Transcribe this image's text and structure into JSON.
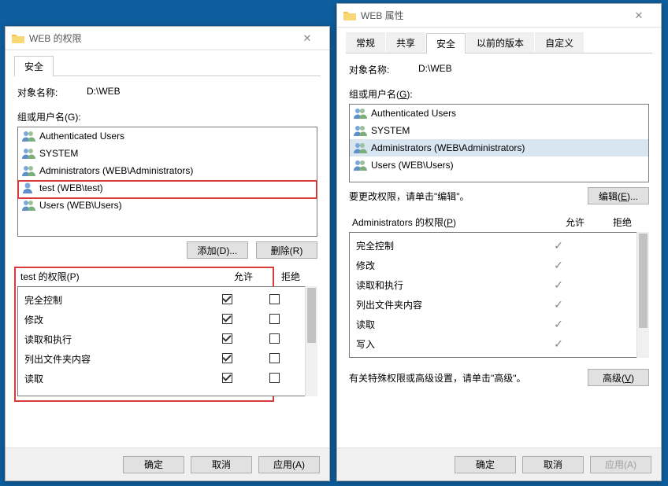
{
  "left": {
    "title": "WEB 的权限",
    "tabs": [
      "安全"
    ],
    "activeTab": 0,
    "objectLabel": "对象名称:",
    "objectValue": "D:\\WEB",
    "groupsLabel": "组或用户名(G):",
    "users": [
      {
        "name": "Authenticated Users",
        "type": "group"
      },
      {
        "name": "SYSTEM",
        "type": "group"
      },
      {
        "name": "Administrators (WEB\\Administrators)",
        "type": "group"
      },
      {
        "name": "test (WEB\\test)",
        "type": "user",
        "highlighted": true
      },
      {
        "name": "Users (WEB\\Users)",
        "type": "group"
      }
    ],
    "btnAdd": "添加(D)...",
    "btnRemove": "删除(R)",
    "permTitle": "test 的权限(P)",
    "colAllow": "允许",
    "colDeny": "拒绝",
    "perms": [
      {
        "name": "完全控制",
        "allow": true,
        "deny": false
      },
      {
        "name": "修改",
        "allow": true,
        "deny": false
      },
      {
        "name": "读取和执行",
        "allow": true,
        "deny": false
      },
      {
        "name": "列出文件夹内容",
        "allow": true,
        "deny": false
      },
      {
        "name": "读取",
        "allow": true,
        "deny": false
      }
    ],
    "btnOk": "确定",
    "btnCancel": "取消",
    "btnApply": "应用(A)"
  },
  "right": {
    "title": "WEB 属性",
    "tabs": [
      "常规",
      "共享",
      "安全",
      "以前的版本",
      "自定义"
    ],
    "activeTab": 2,
    "objectLabel": "对象名称:",
    "objectValue": "D:\\WEB",
    "groupsLabel": "组或用户名(G):",
    "users": [
      {
        "name": "Authenticated Users",
        "type": "group"
      },
      {
        "name": "SYSTEM",
        "type": "group"
      },
      {
        "name": "Administrators (WEB\\Administrators)",
        "type": "group",
        "selected": true
      },
      {
        "name": "Users (WEB\\Users)",
        "type": "group"
      }
    ],
    "editHint": "要更改权限，请单击\"编辑\"。",
    "btnEdit": "编辑(E)...",
    "permTitle": "Administrators 的权限(P)",
    "colAllow": "允许",
    "colDeny": "拒绝",
    "perms": [
      {
        "name": "完全控制",
        "allow": true
      },
      {
        "name": "修改",
        "allow": true
      },
      {
        "name": "读取和执行",
        "allow": true
      },
      {
        "name": "列出文件夹内容",
        "allow": true
      },
      {
        "name": "读取",
        "allow": true
      },
      {
        "name": "写入",
        "allow": true
      }
    ],
    "advancedHint": "有关特殊权限或高级设置，请单击\"高级\"。",
    "btnAdvanced": "高级(V)",
    "btnOk": "确定",
    "btnCancel": "取消",
    "btnApply": "应用(A)"
  }
}
